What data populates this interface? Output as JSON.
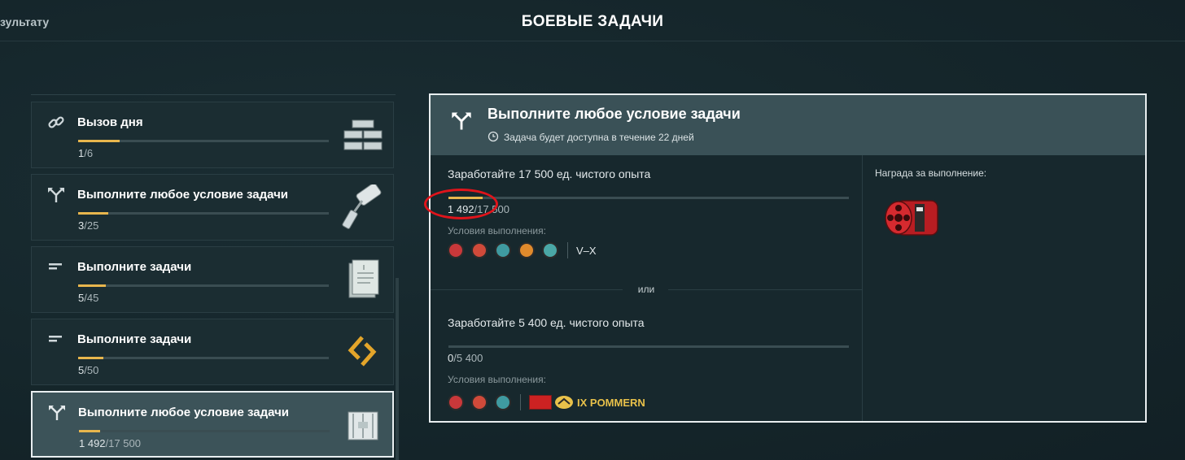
{
  "header": {
    "back_label": "зультату",
    "title": "БОЕВЫЕ ЗАДАЧИ"
  },
  "cards": [
    {
      "icon": "chain-link-icon",
      "title": "Вызов дня",
      "done": "1",
      "total": "/6",
      "fraction": 0.167,
      "picture": "steel-ingots-icon"
    },
    {
      "icon": "fork-arrow-icon",
      "title": "Выполните любое условие задачи",
      "done": "3",
      "total": "/25",
      "fraction": 0.12,
      "picture": "paint-roller-icon"
    },
    {
      "icon": "task-list-icon",
      "title": "Выполните задачи",
      "done": "5",
      "total": "/45",
      "fraction": 0.111,
      "picture": "document-icon"
    },
    {
      "icon": "task-list-icon",
      "title": "Выполните задачи",
      "done": "5",
      "total": "/50",
      "fraction": 0.1,
      "picture": "gold-emblem-icon"
    },
    {
      "icon": "fork-arrow-icon",
      "title": "Выполните любое условие задачи",
      "done": "1 492",
      "total": "/17 500",
      "fraction": 0.085,
      "picture": "supply-container-icon",
      "selected": true
    }
  ],
  "panel": {
    "title": "Выполните любое условие задачи",
    "subtitle": "Задача будет доступна в течение 22 дней",
    "or_label": "или",
    "reward_label": "Награда за выполнение:",
    "reward_icon": "red-camouflage-drum-icon",
    "conditions": [
      {
        "title": "Заработайте 17 500 ед. чистого опыта",
        "done": "1 492",
        "total": "/17 500",
        "fraction": 0.085,
        "req_label": "Условия выполнения:",
        "class_icons": [
          "destroyer-icon",
          "cruiser-icon",
          "battleship-icon",
          "aircraft-carrier-icon",
          "submarine-icon"
        ],
        "tiers": "V–X"
      },
      {
        "title": "Заработайте 5 400 ед. чистого опыта",
        "done": "0",
        "total": "/5 400",
        "fraction": 0,
        "req_label": "Условия выполнения:",
        "class_icons": [
          "destroyer-icon",
          "cruiser-icon",
          "battleship-icon"
        ],
        "ship": "IX POMMERN"
      }
    ]
  },
  "colors": {
    "accent_progress": "#e8b64d",
    "highlight_circle": "#e0141b",
    "ship_name": "#e8c14a"
  }
}
